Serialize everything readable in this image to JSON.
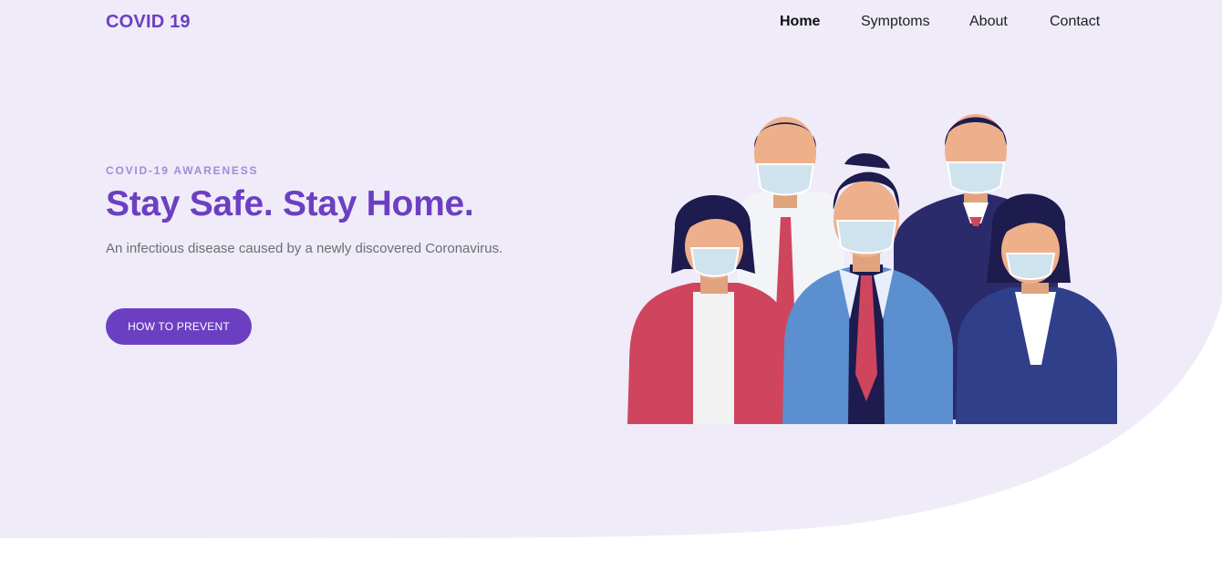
{
  "header": {
    "brand": "COVID 19",
    "nav": [
      {
        "label": "Home",
        "active": true
      },
      {
        "label": "Symptoms",
        "active": false
      },
      {
        "label": "About",
        "active": false
      },
      {
        "label": "Contact",
        "active": false
      }
    ]
  },
  "hero": {
    "eyebrow": "COVID-19 AWARENESS",
    "headline": "Stay Safe. Stay Home.",
    "subtitle": "An infectious disease caused by a newly discovered Coronavirus.",
    "cta_label": "HOW TO PREVENT",
    "illustration_icon": "masked-people-illustration"
  },
  "colors": {
    "primary": "#6c3fc2",
    "eyebrow": "#a58ad9",
    "hero_background": "#efebf8",
    "text_muted": "#6e6e6e"
  }
}
